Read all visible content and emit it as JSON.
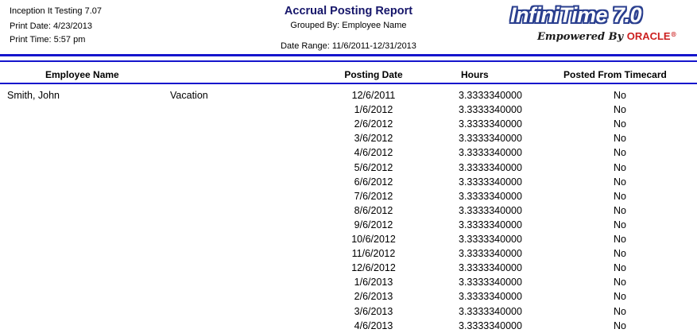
{
  "header": {
    "company": "Inception It Testing 7.07",
    "print_date": "Print Date: 4/23/2013",
    "print_time": "Print Time:  5:57 pm",
    "title": "Accrual Posting Report",
    "grouped_by": "Grouped By:  Employee Name",
    "date_range": "Date Range:  11/6/2011-12/31/2013"
  },
  "logo": {
    "brand": "InfiniTime 7.0",
    "tagline": "Empowered By ",
    "oracle": "ORACLE",
    "reg": "®"
  },
  "columns": {
    "employee_name": "Employee Name",
    "posting_date": "Posting Date",
    "hours": "Hours",
    "posted_from_timecard": "Posted From Timecard"
  },
  "group": {
    "employee": "Smith, John",
    "accrual_type": "Vacation"
  },
  "rows": [
    {
      "date": "12/6/2011",
      "hours": "3.3333340000",
      "posted": "No"
    },
    {
      "date": "1/6/2012",
      "hours": "3.3333340000",
      "posted": "No"
    },
    {
      "date": "2/6/2012",
      "hours": "3.3333340000",
      "posted": "No"
    },
    {
      "date": "3/6/2012",
      "hours": "3.3333340000",
      "posted": "No"
    },
    {
      "date": "4/6/2012",
      "hours": "3.3333340000",
      "posted": "No"
    },
    {
      "date": "5/6/2012",
      "hours": "3.3333340000",
      "posted": "No"
    },
    {
      "date": "6/6/2012",
      "hours": "3.3333340000",
      "posted": "No"
    },
    {
      "date": "7/6/2012",
      "hours": "3.3333340000",
      "posted": "No"
    },
    {
      "date": "8/6/2012",
      "hours": "3.3333340000",
      "posted": "No"
    },
    {
      "date": "9/6/2012",
      "hours": "3.3333340000",
      "posted": "No"
    },
    {
      "date": "10/6/2012",
      "hours": "3.3333340000",
      "posted": "No"
    },
    {
      "date": "11/6/2012",
      "hours": "3.3333340000",
      "posted": "No"
    },
    {
      "date": "12/6/2012",
      "hours": "3.3333340000",
      "posted": "No"
    },
    {
      "date": "1/6/2013",
      "hours": "3.3333340000",
      "posted": "No"
    },
    {
      "date": "2/6/2013",
      "hours": "3.3333340000",
      "posted": "No"
    },
    {
      "date": "3/6/2013",
      "hours": "3.3333340000",
      "posted": "No"
    },
    {
      "date": "4/6/2013",
      "hours": "3.3333340000",
      "posted": "No"
    }
  ],
  "colors": {
    "rule": "#1515cc",
    "title": "#16166a",
    "logo_outline": "#2a3f8f",
    "oracle": "#cc1f1f"
  }
}
